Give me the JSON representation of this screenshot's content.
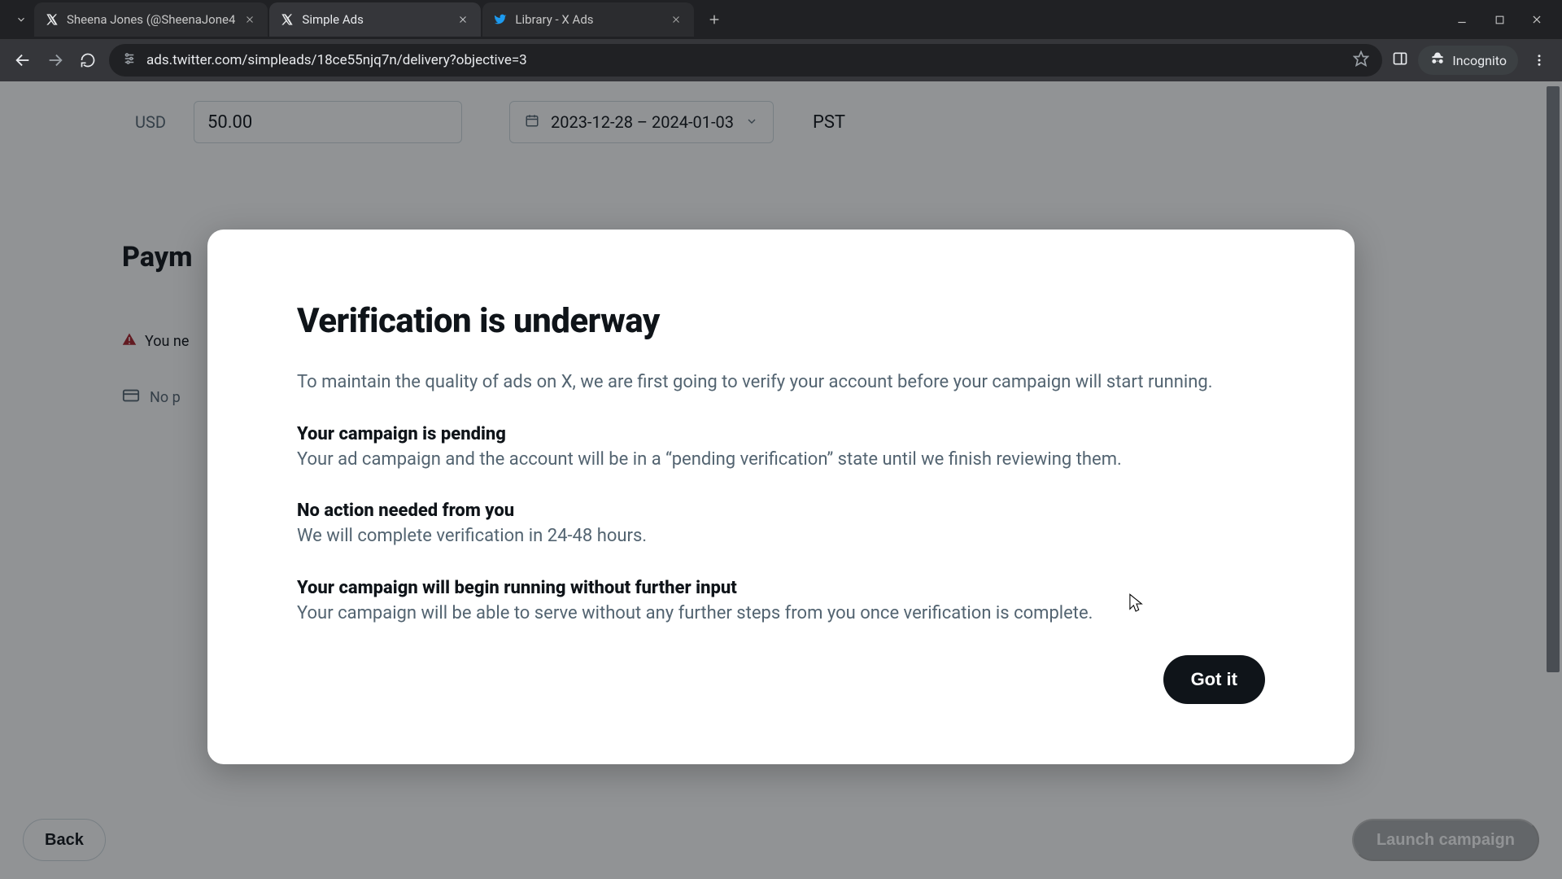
{
  "browser": {
    "tabs": [
      {
        "title": "Sheena Jones (@SheenaJone4",
        "favicon": "x-logo",
        "active": false
      },
      {
        "title": "Simple Ads",
        "favicon": "x-logo",
        "active": true
      },
      {
        "title": "Library - X Ads",
        "favicon": "twitter-bird",
        "active": false
      }
    ],
    "url": "ads.twitter.com/simpleads/18ce55njq7n/delivery?objective=3",
    "incognito_label": "Incognito"
  },
  "page": {
    "currency": "USD",
    "budget_value": "50.00",
    "date_range": "2023-12-28 – 2024-01-03",
    "timezone": "PST",
    "payment_heading": "Paym",
    "warning_text": "You ne",
    "no_payment_text": "No p",
    "back_label": "Back",
    "launch_label": "Launch campaign"
  },
  "modal": {
    "title": "Verification is underway",
    "lead": "To maintain the quality of ads on X, we are first going to verify your account before your campaign will start running.",
    "sections": [
      {
        "title": "Your campaign is pending",
        "body": "Your ad campaign and the account will be in a “pending verification” state until we finish reviewing them."
      },
      {
        "title": "No action needed from you",
        "body": "We will complete verification in 24-48 hours."
      },
      {
        "title": "Your campaign will begin running without further input",
        "body": "Your campaign will be able to serve without any further steps from you once verification is complete."
      }
    ],
    "cta": "Got it"
  }
}
